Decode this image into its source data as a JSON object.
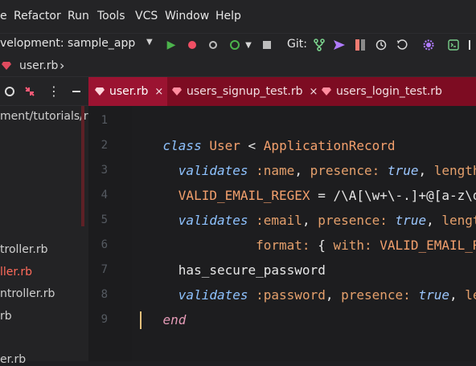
{
  "menu": {
    "items": [
      "e",
      "Refactor",
      "Run",
      "Tools",
      "VCS",
      "Window",
      "Help"
    ]
  },
  "toolbar": {
    "config_label": "velopment: sample_app",
    "git_label": "Git:",
    "icons": [
      "run-icon",
      "debug-icon",
      "coverage-icon",
      "profiler-icon",
      "stop-icon",
      "branch-icon",
      "push-icon",
      "compare-icon",
      "history-icon",
      "rollback-icon",
      "settings-icon",
      "terminal-icon"
    ]
  },
  "breadcrumb": {
    "file": "user.rb",
    "chevron": "›"
  },
  "project": {
    "path_fragment": "ment/tutorials/ra",
    "items": [
      {
        "label": "troller.rb",
        "danger": false
      },
      {
        "label": "ller.rb",
        "danger": true
      },
      {
        "label": "ntroller.rb",
        "danger": false
      },
      {
        "label": "rb",
        "danger": false
      },
      {
        "label": "er.rb",
        "danger": false
      }
    ]
  },
  "tabs": [
    {
      "label": "user.rb",
      "active": true
    },
    {
      "label": "users_signup_test.rb",
      "active": false
    },
    {
      "label": "users_login_test.rb",
      "active": false
    }
  ],
  "editor": {
    "line_numbers": [
      "1",
      "2",
      "3",
      "4",
      "5",
      "6",
      "7",
      "8",
      "9"
    ],
    "lines": [
      "class User < ApplicationRecord",
      "  validates :name, presence: true, length:",
      "  VALID_EMAIL_REGEX = /\\A[\\w+\\-.]+@[a-z\\d\\",
      "  validates :email, presence: true, length",
      "            format: { with: VALID_EMAIL_RE",
      "  has_secure_password",
      "  validates :password, presence: true, len",
      "end",
      ""
    ]
  },
  "colors": {
    "accent": "#7d0c22",
    "active_tab": "#9b1331",
    "keyword": "#8ec2ff",
    "constant": "#f3a06d"
  }
}
